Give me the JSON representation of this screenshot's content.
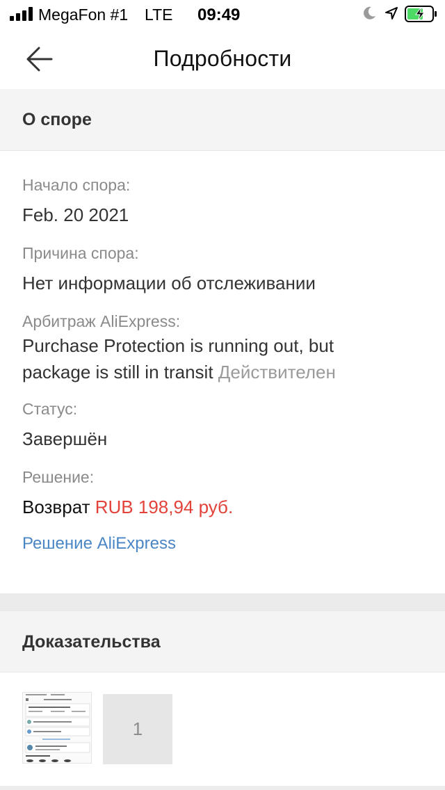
{
  "status_bar": {
    "carrier": "MegaFon #1",
    "network": "LTE",
    "time": "09:49"
  },
  "nav": {
    "title": "Подробности"
  },
  "dispute_section": {
    "header": "О споре",
    "start_label": "Начало спора:",
    "start_value": "Feb. 20 2021",
    "reason_label": "Причина спора:",
    "reason_value": "Нет информации об отслеживании",
    "arbitration_label": "Арбитраж AliExpress:",
    "arbitration_line1": "Purchase Protection is running out, but",
    "arbitration_line2": "package is still in transit",
    "arbitration_state": "Действителен",
    "status_label": "Статус:",
    "status_value": "Завершён",
    "decision_label": "Решение:",
    "decision_value": "Возврат",
    "decision_amount": "RUB 198,94 руб.",
    "decision_link": "Решение AliExpress"
  },
  "evidence_section": {
    "header": "Доказательства",
    "count": "1"
  },
  "colors": {
    "accent_price": "#e2423a",
    "link": "#4a86c5",
    "header_bg": "#f4f4f4",
    "battery_green": "#4cd964"
  }
}
